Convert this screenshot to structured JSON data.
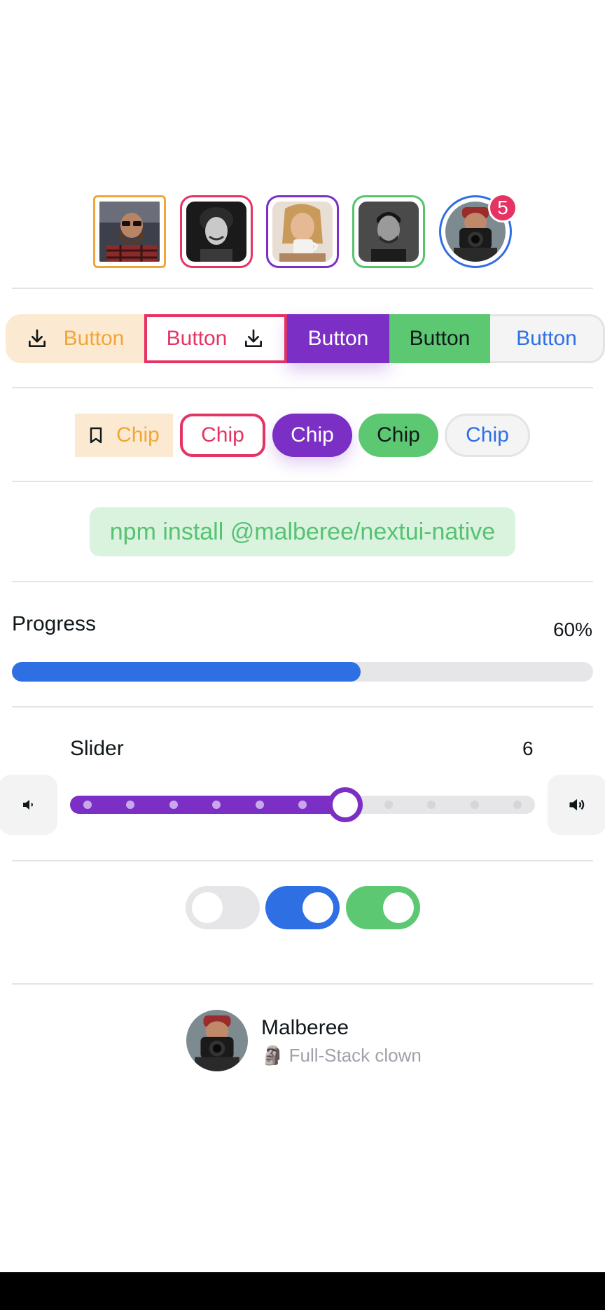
{
  "avatars": [
    {
      "name": "avatar-bearded-man",
      "color": "#f0a639"
    },
    {
      "name": "avatar-smiling-man",
      "color": "#e53463"
    },
    {
      "name": "avatar-woman-coffee",
      "color": "#7b2fc4"
    },
    {
      "name": "avatar-man-portrait",
      "color": "#55c46b"
    },
    {
      "name": "avatar-photographer",
      "color": "#2f6fe4",
      "badge": "5"
    }
  ],
  "buttons": [
    {
      "label": "Button",
      "icon": "download-icon",
      "style": "flat-warning"
    },
    {
      "label": "Button",
      "icon": "download-icon",
      "style": "bordered-danger"
    },
    {
      "label": "Button",
      "style": "shadow-secondary"
    },
    {
      "label": "Button",
      "style": "solid-success"
    },
    {
      "label": "Button",
      "style": "faded-primary"
    }
  ],
  "chips": [
    {
      "label": "Chip",
      "icon": "bookmark-icon"
    },
    {
      "label": "Chip"
    },
    {
      "label": "Chip"
    },
    {
      "label": "Chip"
    },
    {
      "label": "Chip"
    }
  ],
  "snippet": {
    "text": "npm install @malberee/nextui-native"
  },
  "progress": {
    "label": "Progress",
    "value_text": "60%",
    "value": 0.6
  },
  "slider": {
    "label": "Slider",
    "value_text": "6",
    "value": 6,
    "min": 0,
    "max": 10,
    "step": 1
  },
  "switches": [
    {
      "name": "switch-default",
      "on": false
    },
    {
      "name": "switch-primary",
      "on": true
    },
    {
      "name": "switch-success",
      "on": true
    }
  ],
  "user": {
    "name": "Malberee",
    "description": "🗿 Full-Stack clown"
  },
  "colors": {
    "warning": "#f0a639",
    "danger": "#e53463",
    "secondary": "#7b2fc4",
    "success": "#55c46b",
    "primary": "#2f6fe4",
    "default_track": "#e6e6e9"
  }
}
